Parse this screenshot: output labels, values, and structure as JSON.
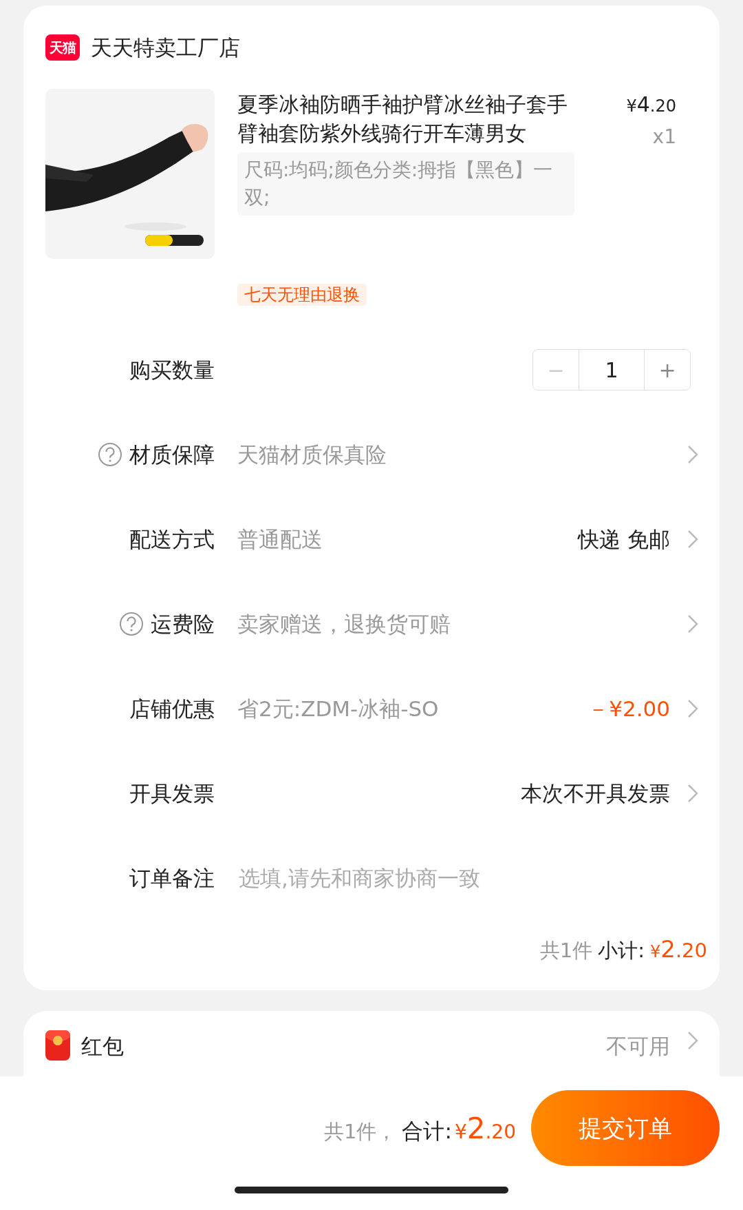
{
  "shop": {
    "badge": "天猫",
    "name": "天天特卖工厂店"
  },
  "product": {
    "title": "夏季冰袖防晒手袖护臂冰丝袖子套手臂袖套防紫外线骑行开车薄男女",
    "currency": "¥",
    "integer": "4",
    "decimal": ".20",
    "quantity": "x1",
    "spec": "尺码:均码;颜色分类:拇指【黑色】一双;",
    "tag": "七天无理由退换"
  },
  "rows": [
    {
      "kind": "stepper",
      "label": "购买数量",
      "minus": "−",
      "value": "1",
      "plus": "+",
      "minus_disabled": true
    },
    {
      "kind": "link",
      "help": true,
      "label": "材质保障",
      "value": "天猫材质保真险"
    },
    {
      "kind": "link",
      "help": false,
      "label": "配送方式",
      "value": "普通配送",
      "detail": "快递 免邮",
      "highlighted": false
    },
    {
      "kind": "link",
      "help": true,
      "label": "运费险",
      "value": "卖家赠送，退换货可赔"
    },
    {
      "kind": "link",
      "help": false,
      "label": "店铺优惠",
      "value": "省2元:ZDM-冰袖-SO",
      "detail": "－¥2.00",
      "highlighted": true
    },
    {
      "kind": "link",
      "help": false,
      "label": "开具发票",
      "detail": "本次不开具发票",
      "highlighted": false
    },
    {
      "kind": "input",
      "label": "订单备注",
      "placeholder": "选填,请先和商家协商一致"
    }
  ],
  "subtotal": {
    "count": "共1件",
    "label": "小计:",
    "currency": "¥",
    "integer": "2",
    "decimal": ".20"
  },
  "bonus": {
    "label": "红包",
    "value": "不可用"
  },
  "footer": {
    "count": "共1件，",
    "label": "合计:",
    "currency": "¥",
    "integer": "2",
    "decimal": ".20",
    "button": "提交订单"
  }
}
